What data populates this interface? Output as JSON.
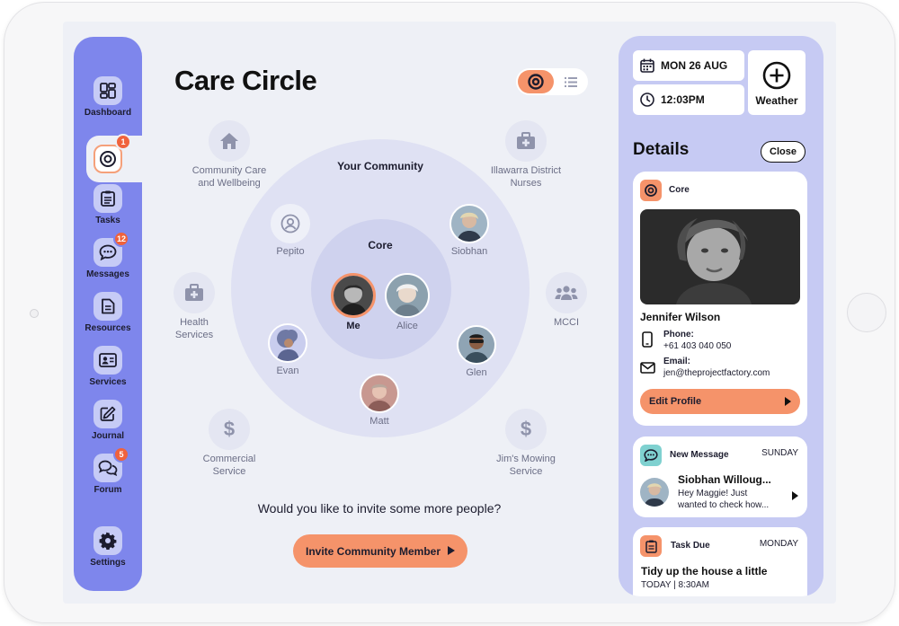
{
  "sidebar": {
    "items": [
      {
        "label": "Dashboard",
        "icon": "dashboard-icon"
      },
      {
        "label": "",
        "icon": "care-circle-icon",
        "badge": "1"
      },
      {
        "label": "Tasks",
        "icon": "clipboard-icon"
      },
      {
        "label": "Messages",
        "icon": "chat-icon",
        "badge": "12"
      },
      {
        "label": "Resources",
        "icon": "document-icon"
      },
      {
        "label": "Services",
        "icon": "id-card-icon"
      },
      {
        "label": "Journal",
        "icon": "pencil-icon"
      },
      {
        "label": "Forum",
        "icon": "forum-icon",
        "badge": "5"
      },
      {
        "label": "Settings",
        "icon": "gear-icon"
      }
    ]
  },
  "main": {
    "title": "Care Circle",
    "rings": {
      "outer": "Your Community",
      "inner": "Core"
    },
    "community_nodes": [
      {
        "label": "Community Care and Wellbeing",
        "icon": "home-icon"
      },
      {
        "label": "Illawarra District Nurses",
        "icon": "medical-kit-icon"
      },
      {
        "label": "Health Services",
        "icon": "medical-kit-icon"
      },
      {
        "label": "MCCI",
        "icon": "group-icon"
      },
      {
        "label": "Commercial Service",
        "icon": "dollar-icon"
      },
      {
        "label": "Jim's Mowing Service",
        "icon": "dollar-icon"
      }
    ],
    "people": {
      "pepito": "Pepito",
      "siobhan": "Siobhan",
      "evan": "Evan",
      "glen": "Glen",
      "matt": "Matt",
      "me": "Me",
      "alice": "Alice"
    },
    "invite_question": "Would you like to invite some more people?",
    "invite_button": "Invite Community Member"
  },
  "right_panel": {
    "date": "MON 26 AUG",
    "time": "12:03PM",
    "weather": "Weather",
    "details_title": "Details",
    "close": "Close",
    "profile": {
      "tag": "Core",
      "name": "Jennifer Wilson",
      "phone_label": "Phone:",
      "phone": "+61 403 040 050",
      "email_label": "Email:",
      "email": "jen@theprojectfactory.com",
      "edit_button": "Edit Profile"
    },
    "message": {
      "title": "New Message",
      "day": "SUNDAY",
      "sender": "Siobhan Willoug...",
      "preview_line1": "Hey Maggie! Just",
      "preview_line2": "wanted to check how..."
    },
    "task": {
      "title": "Task Due",
      "day": "MONDAY",
      "text": "Tidy up the house a little",
      "when": "TODAY | 8:30AM"
    }
  },
  "colors": {
    "sidebar": "#7e86ec",
    "accent": "#f5936a",
    "badge": "#f0623c",
    "panel": "#c6caf3",
    "message_icon": "#7fd1d0"
  }
}
